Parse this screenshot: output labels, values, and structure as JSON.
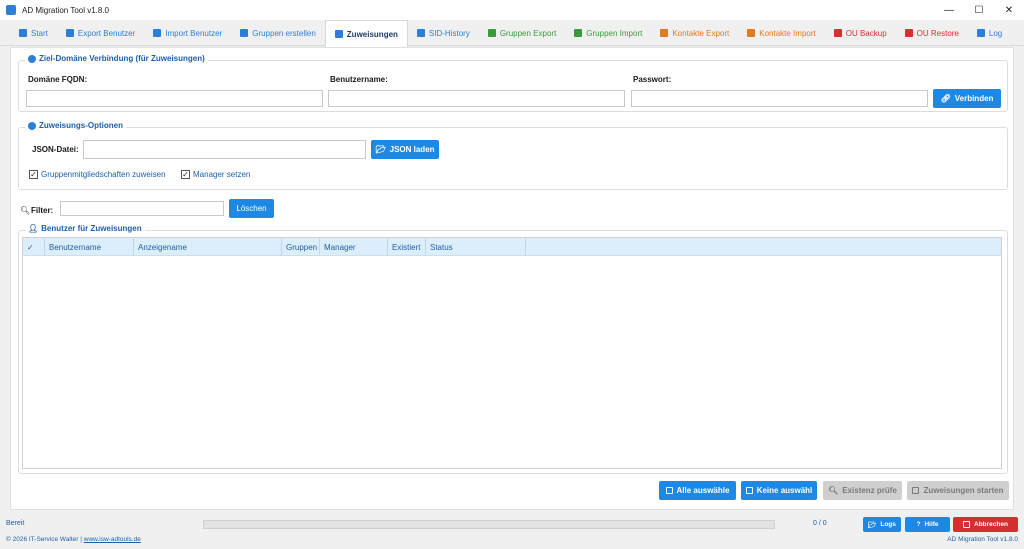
{
  "window": {
    "title": "AD Migration Tool v1.8.0",
    "controls": [
      "—",
      "☐",
      "✕"
    ]
  },
  "tabs": [
    {
      "label": "Start",
      "color": "#2d7fd3",
      "active": false
    },
    {
      "label": "Export Benutzer",
      "color": "#2d7fd3",
      "active": false
    },
    {
      "label": "Import Benutzer",
      "color": "#2d7fd3",
      "active": false
    },
    {
      "label": "Gruppen erstellen",
      "color": "#2d7fd3",
      "active": false
    },
    {
      "label": "Zuweisungen",
      "color": "#2d7fd3",
      "active": true
    },
    {
      "label": "SID-History",
      "color": "#2d7fd3",
      "active": false
    },
    {
      "label": "Gruppen Export",
      "color": "#3a9a3a",
      "active": false
    },
    {
      "label": "Gruppen Import",
      "color": "#3a9a3a",
      "active": false
    },
    {
      "label": "Kontakte Export",
      "color": "#e07b20",
      "active": false
    },
    {
      "label": "Kontakte Import",
      "color": "#e07b20",
      "active": false
    },
    {
      "label": "OU Backup",
      "color": "#d62f2f",
      "active": false
    },
    {
      "label": "OU Restore",
      "color": "#d62f2f",
      "active": false
    },
    {
      "label": "Log",
      "color": "#2d7fd3",
      "active": false
    }
  ],
  "connection": {
    "title": "Ziel-Domäne Verbindung (für Zuweisungen)",
    "domain_label": "Domäne FQDN:",
    "domain_value": "",
    "user_label": "Benutzername:",
    "user_value": "",
    "password_label": "Passwort:",
    "password_value": "",
    "connect_button": "Verbinden"
  },
  "options": {
    "title": "Zuweisungs-Optionen",
    "json_label": "JSON-Datei:",
    "json_value": "",
    "json_button": "JSON laden",
    "check_groups": "Gruppenmitgliedschaften zuweisen",
    "check_groups_checked": true,
    "check_manager": "Manager setzen",
    "check_manager_checked": true
  },
  "filter": {
    "label": "Filter:",
    "value": "",
    "clear_button": "Löschen"
  },
  "users": {
    "title": "Benutzer für Zuweisungen",
    "columns": [
      "✓",
      "Benutzername",
      "Anzeigename",
      "Gruppen",
      "Manager",
      "Existiert",
      "Status"
    ],
    "rows": []
  },
  "actions": {
    "select_all": "Alle auswähle",
    "select_none": "Keine auswähl",
    "check_existence": "Existenz prüfe",
    "start": "Zuweisungen starten"
  },
  "status": {
    "text": "Bereit",
    "progress": 0,
    "count": "0 / 0",
    "copyright_prefix": "© 2026 IT-Service Walter | ",
    "copyright_link": "www.isw-adtools.de",
    "version": "AD Migration Tool v1.8.0",
    "log_button": "Logs",
    "help_button": "Hilfe",
    "cancel_button": "Abbrechen"
  }
}
